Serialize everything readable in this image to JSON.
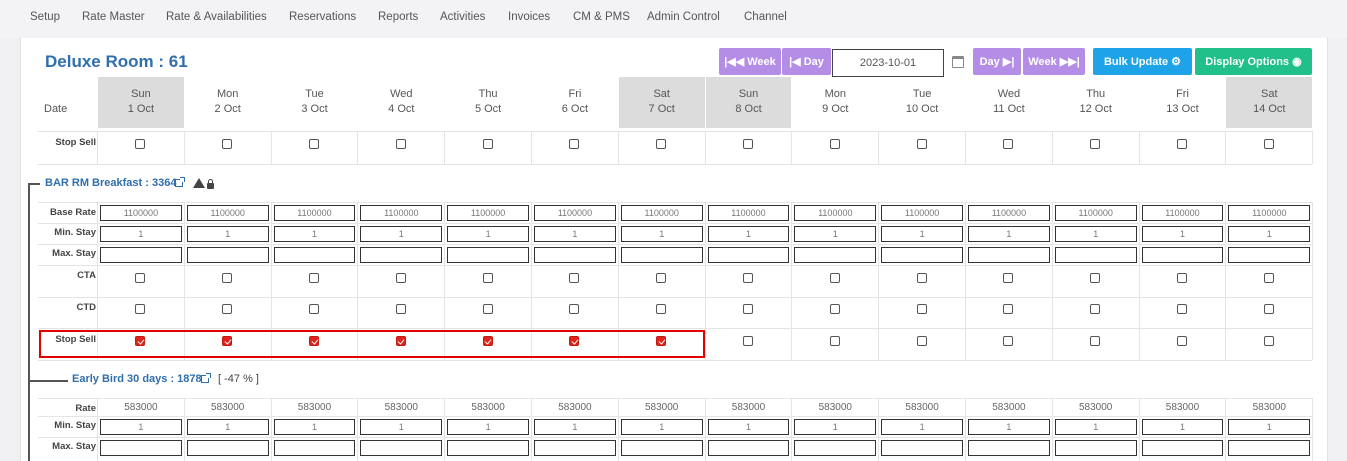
{
  "nav": [
    "Setup",
    "Rate Master",
    "Rate & Availabilities",
    "Reservations",
    "Reports",
    "Activities",
    "Invoices",
    "CM & PMS",
    "Admin Control",
    "Channel"
  ],
  "room_title": "Deluxe Room : 61",
  "toolbar": {
    "prev_week": "Week",
    "prev_day": "Day",
    "date_value": "2023-10-01",
    "next_day": "Day",
    "next_week": "Week",
    "bulk_update": "Bulk Update",
    "display_options": "Display Options",
    "colors": {
      "purple": "#b48ee6",
      "blue": "#1ea2e8",
      "green": "#21bf8a"
    }
  },
  "date_label": "Date",
  "days": [
    {
      "dow": "Sun",
      "date": "1 Oct",
      "weekend": true
    },
    {
      "dow": "Mon",
      "date": "2 Oct",
      "weekend": false
    },
    {
      "dow": "Tue",
      "date": "3 Oct",
      "weekend": false
    },
    {
      "dow": "Wed",
      "date": "4 Oct",
      "weekend": false
    },
    {
      "dow": "Thu",
      "date": "5 Oct",
      "weekend": false
    },
    {
      "dow": "Fri",
      "date": "6 Oct",
      "weekend": false
    },
    {
      "dow": "Sat",
      "date": "7 Oct",
      "weekend": true
    },
    {
      "dow": "Sun",
      "date": "8 Oct",
      "weekend": true
    },
    {
      "dow": "Mon",
      "date": "9 Oct",
      "weekend": false
    },
    {
      "dow": "Tue",
      "date": "10 Oct",
      "weekend": false
    },
    {
      "dow": "Wed",
      "date": "11 Oct",
      "weekend": false
    },
    {
      "dow": "Thu",
      "date": "12 Oct",
      "weekend": false
    },
    {
      "dow": "Fri",
      "date": "13 Oct",
      "weekend": false
    },
    {
      "dow": "Sat",
      "date": "14 Oct",
      "weekend": true
    }
  ],
  "room_stop_sell": {
    "label": "Stop Sell",
    "values": [
      false,
      false,
      false,
      false,
      false,
      false,
      false,
      false,
      false,
      false,
      false,
      false,
      false,
      false
    ]
  },
  "plans": [
    {
      "title": "BAR RM Breakfast : 3364",
      "icons": [
        "external-link-icon",
        "warning-icon",
        "lock-icon"
      ],
      "base_rate_label": "Base Rate",
      "base_rate": [
        "1100000",
        "1100000",
        "1100000",
        "1100000",
        "1100000",
        "1100000",
        "1100000",
        "1100000",
        "1100000",
        "1100000",
        "1100000",
        "1100000",
        "1100000",
        "1100000"
      ],
      "min_stay_label": "Min. Stay",
      "min_stay": [
        "1",
        "1",
        "1",
        "1",
        "1",
        "1",
        "1",
        "1",
        "1",
        "1",
        "1",
        "1",
        "1",
        "1"
      ],
      "max_stay_label": "Max. Stay",
      "max_stay": [
        "",
        "",
        "",
        "",
        "",
        "",
        "",
        "",
        "",
        "",
        "",
        "",
        "",
        ""
      ],
      "cta_label": "CTA",
      "cta": [
        false,
        false,
        false,
        false,
        false,
        false,
        false,
        false,
        false,
        false,
        false,
        false,
        false,
        false
      ],
      "ctd_label": "CTD",
      "ctd": [
        false,
        false,
        false,
        false,
        false,
        false,
        false,
        false,
        false,
        false,
        false,
        false,
        false,
        false
      ],
      "stop_sell_label": "Stop Sell",
      "stop_sell": [
        true,
        true,
        true,
        true,
        true,
        true,
        true,
        false,
        false,
        false,
        false,
        false,
        false,
        false
      ],
      "checked_color": "#e0241b"
    },
    {
      "title": "Early Bird 30 days : 1878",
      "discount": "[ -47 % ]",
      "rate_label": "Rate",
      "rate": [
        "583000",
        "583000",
        "583000",
        "583000",
        "583000",
        "583000",
        "583000",
        "583000",
        "583000",
        "583000",
        "583000",
        "583000",
        "583000",
        "583000"
      ],
      "min_stay_label": "Min. Stay",
      "min_stay": [
        "1",
        "1",
        "1",
        "1",
        "1",
        "1",
        "1",
        "1",
        "1",
        "1",
        "1",
        "1",
        "1",
        "1"
      ],
      "max_stay_label": "Max. Stay",
      "max_stay": [
        "",
        "",
        "",
        "",
        "",
        "",
        "",
        "",
        "",
        "",
        "",
        "",
        "",
        ""
      ]
    }
  ]
}
